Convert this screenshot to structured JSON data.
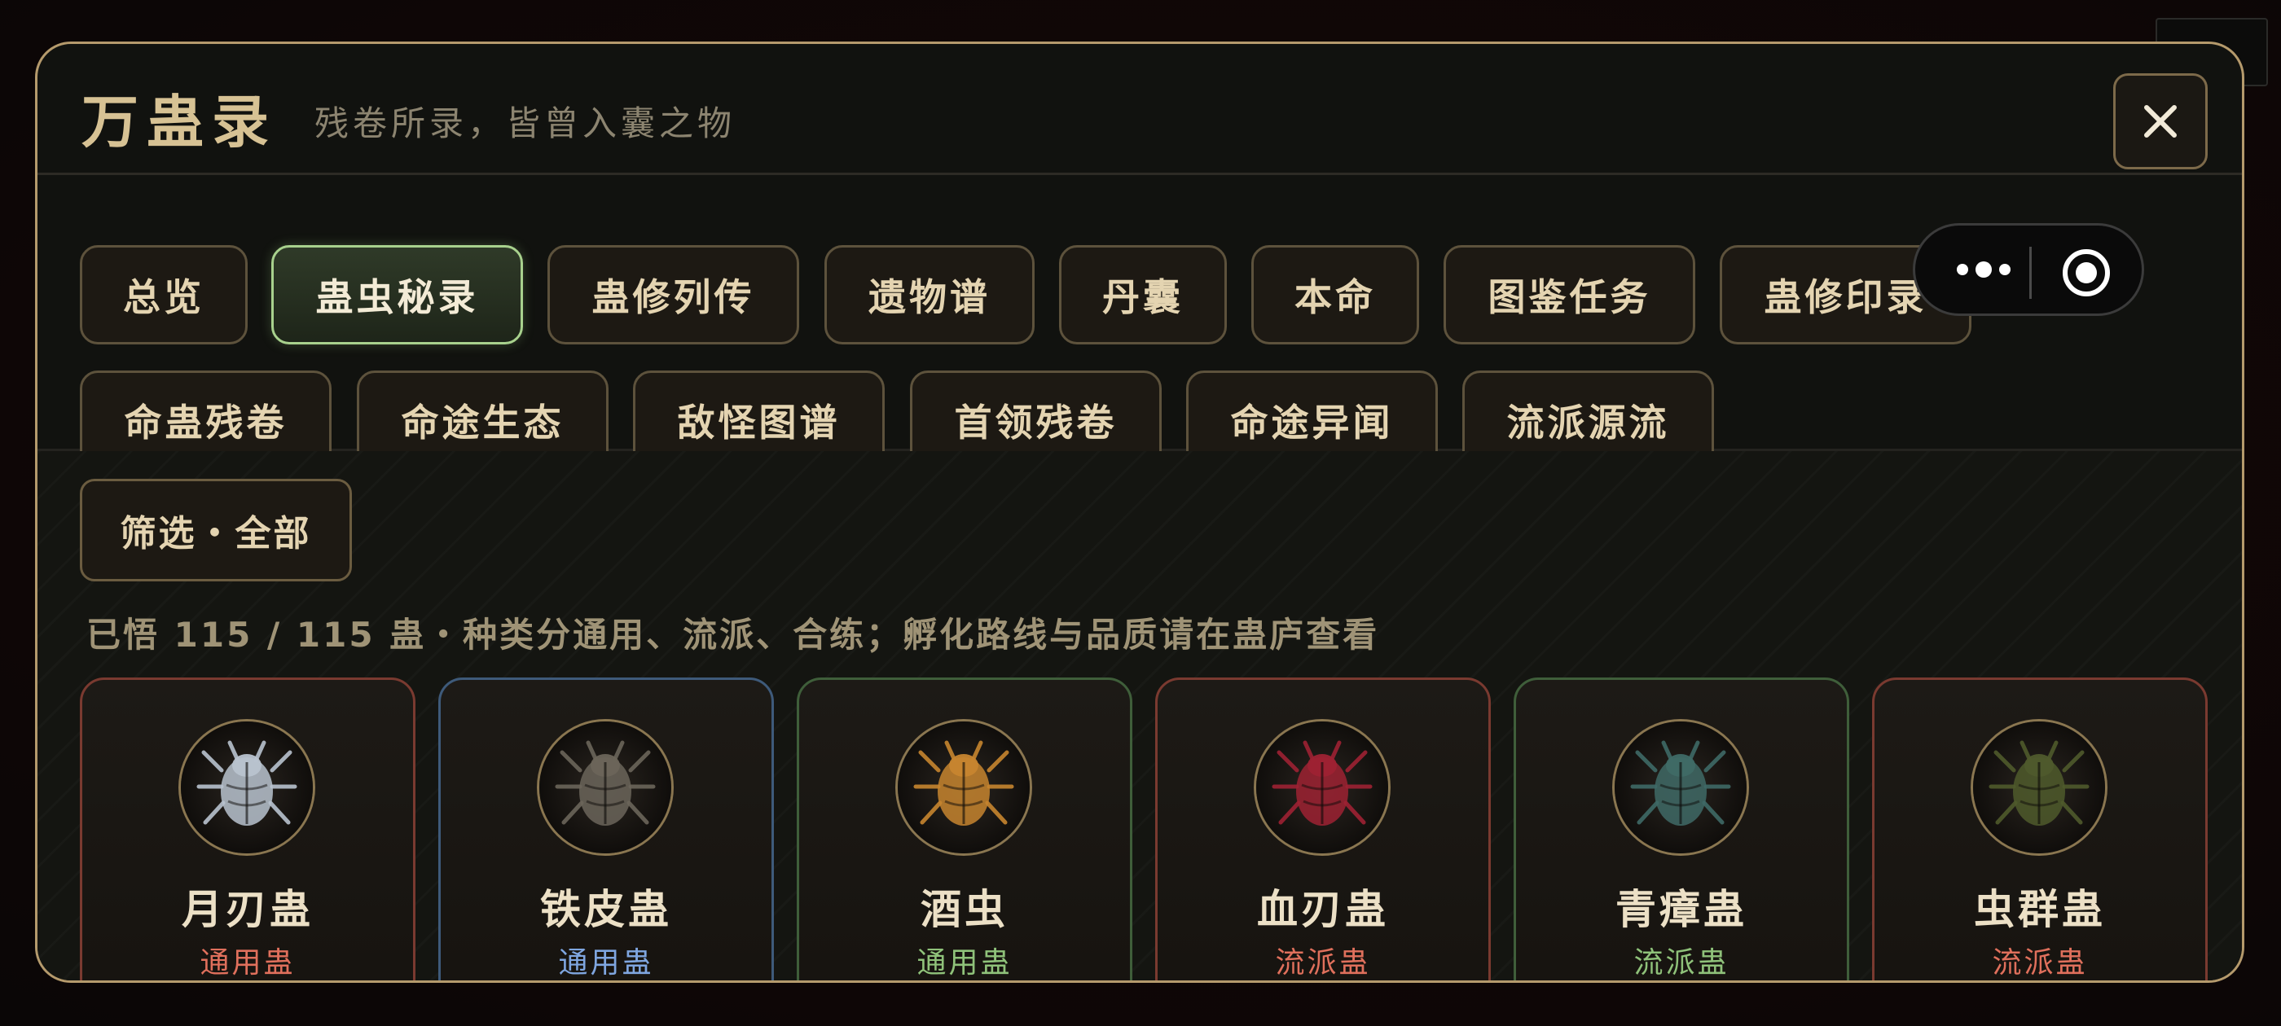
{
  "header": {
    "title": "万蛊录",
    "subtitle": "残卷所录，皆曾入囊之物"
  },
  "tabs": [
    {
      "label": "总览"
    },
    {
      "label": "蛊虫秘录"
    },
    {
      "label": "蛊修列传"
    },
    {
      "label": "遗物谱"
    },
    {
      "label": "丹囊"
    },
    {
      "label": "本命"
    },
    {
      "label": "图鉴任务"
    },
    {
      "label": "蛊修印录"
    },
    {
      "label": "命蛊残卷"
    },
    {
      "label": "命途生态"
    },
    {
      "label": "敌怪图谱"
    },
    {
      "label": "首领残卷"
    },
    {
      "label": "命途异闻"
    },
    {
      "label": "流派源流"
    }
  ],
  "active_tab": "蛊虫秘录",
  "filter": {
    "label": "筛选・全部"
  },
  "summary": "已悟 115 / 115 蛊・种类分通用、流派、合练；孵化路线与品质请在蛊庐查看",
  "cards": [
    {
      "name": "月刃蛊",
      "type": "通用蛊",
      "type_color": "#e0705c",
      "border_color": "#7a3a30",
      "icon": "silver-blade-insect-icon",
      "tint": "#b9c3cf"
    },
    {
      "name": "铁皮蛊",
      "type": "通用蛊",
      "type_color": "#7fa6e0",
      "border_color": "#3e5a7a",
      "icon": "iron-shell-insect-icon",
      "tint": "#6b655a"
    },
    {
      "name": "酒虫",
      "type": "通用蛊",
      "type_color": "#8fc27a",
      "border_color": "#3f5e3a",
      "icon": "wine-bug-icon",
      "tint": "#c7852f"
    },
    {
      "name": "血刃蛊",
      "type": "流派蛊",
      "type_color": "#e0705c",
      "border_color": "#7a3a30",
      "icon": "blood-blade-insect-icon",
      "tint": "#9e2233"
    },
    {
      "name": "青瘴蛊",
      "type": "流派蛊",
      "type_color": "#8fc27a",
      "border_color": "#3f5e3a",
      "icon": "miasma-insect-icon",
      "tint": "#3f6a66"
    },
    {
      "name": "虫群蛊",
      "type": "流派蛊",
      "type_color": "#e0705c",
      "border_color": "#7a3a30",
      "icon": "swarm-insect-icon",
      "tint": "#4f5a2c"
    }
  ]
}
